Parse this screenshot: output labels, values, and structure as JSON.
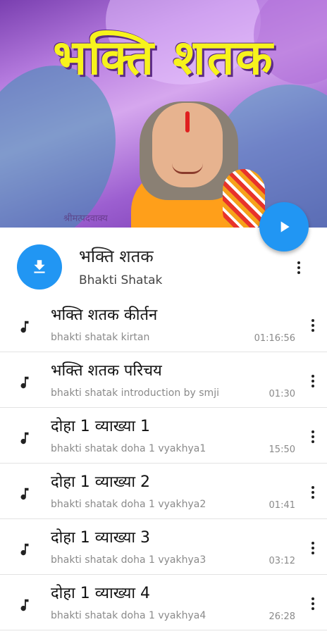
{
  "banner": {
    "title": "भक्ति शतक",
    "watermark": "श्रीमत्पदवाक्य"
  },
  "album": {
    "title": "भक्ति शतक",
    "subtitle": "Bhakti Shatak",
    "play_icon": "play-icon",
    "download_icon": "download-icon",
    "menu_icon": "more-vert-icon"
  },
  "tracks": [
    {
      "title": "भक्ति शतक कीर्तन",
      "subtitle": "bhakti shatak kirtan",
      "duration": "01:16:56"
    },
    {
      "title": "भक्ति शतक परिचय",
      "subtitle": "bhakti shatak introduction by smji",
      "duration": "01:30"
    },
    {
      "title": "दोहा 1 व्याख्या 1",
      "subtitle": "bhakti shatak doha 1 vyakhya1",
      "duration": "15:50"
    },
    {
      "title": "दोहा 1 व्याख्या 2",
      "subtitle": "bhakti shatak doha 1 vyakhya2",
      "duration": "01:41"
    },
    {
      "title": "दोहा 1 व्याख्या 3",
      "subtitle": "bhakti shatak doha 1 vyakhya3",
      "duration": "03:12"
    },
    {
      "title": "दोहा 1 व्याख्या 4",
      "subtitle": "bhakti shatak doha 1 vyakhya4",
      "duration": "26:28"
    }
  ],
  "colors": {
    "accent": "#2196f3",
    "title_yellow": "#f7f31c",
    "banner_purple": "#9c5fd0"
  }
}
